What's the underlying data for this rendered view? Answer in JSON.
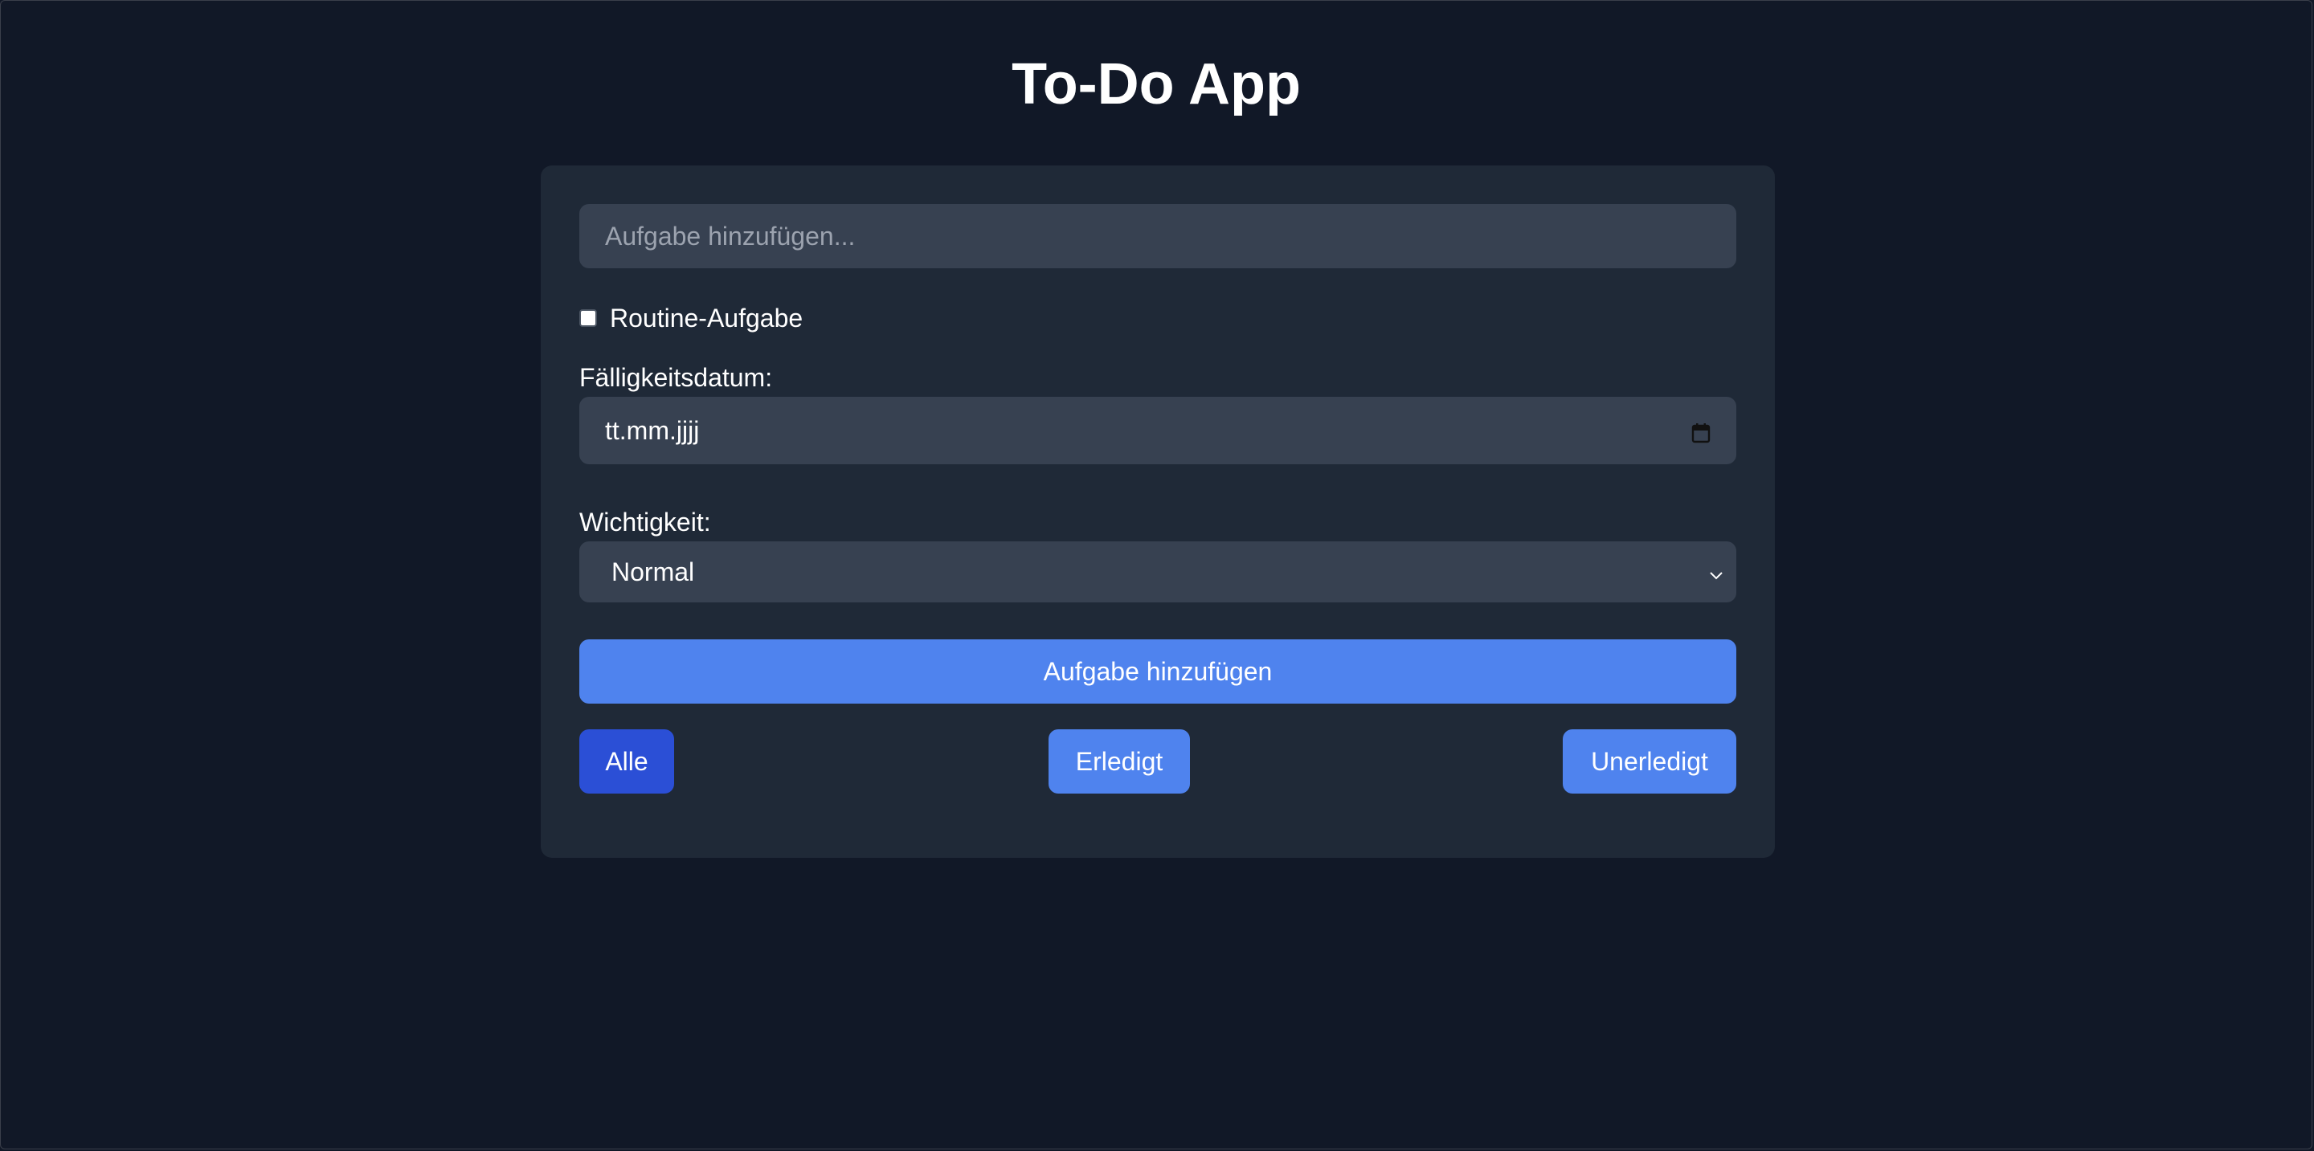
{
  "app": {
    "title": "To-Do App"
  },
  "form": {
    "task_input": {
      "value": "",
      "placeholder": "Aufgabe hinzufügen..."
    },
    "routine_checkbox": {
      "label": "Routine-Aufgabe",
      "checked": false
    },
    "due_date": {
      "label": "Fälligkeitsdatum:",
      "placeholder": "tt.mm.jjjj",
      "icon": "calendar-icon"
    },
    "priority": {
      "label": "Wichtigkeit:",
      "selected": "Normal",
      "icon": "chevron-down-icon"
    },
    "add_button_label": "Aufgabe hinzufügen"
  },
  "filters": {
    "all_label": "Alle",
    "done_label": "Erledigt",
    "open_label": "Unerledigt",
    "active": "Alle"
  },
  "colors": {
    "background": "#111827",
    "card": "#1f2937",
    "input": "#374151",
    "button": "#4f83ee",
    "button_active": "#2b4fd6",
    "text": "#ffffff",
    "placeholder": "#9ca3af"
  }
}
